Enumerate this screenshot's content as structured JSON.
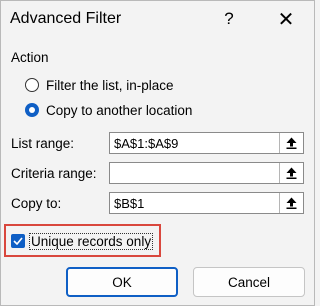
{
  "dialog": {
    "title": "Advanced Filter",
    "help_glyph": "?",
    "close_glyph": "✕"
  },
  "action": {
    "label": "Action",
    "options": [
      {
        "label": "Filter the list, in-place",
        "selected": false
      },
      {
        "label": "Copy to another location",
        "selected": true
      }
    ]
  },
  "fields": {
    "list_range": {
      "label": "List range:",
      "value": "$A$1:$A$9"
    },
    "criteria_range": {
      "label": "Criteria range:",
      "value": ""
    },
    "copy_to": {
      "label": "Copy to:",
      "value": "$B$1"
    }
  },
  "unique_records": {
    "label": "Unique records only",
    "checked": true
  },
  "buttons": {
    "ok": "OK",
    "cancel": "Cancel"
  },
  "colors": {
    "accent": "#0f5fc5",
    "highlight": "#d9473d",
    "background": "#f3f3f3"
  },
  "icons": {
    "collapse": "collapse-dialog-icon",
    "check": "checkmark-icon"
  }
}
